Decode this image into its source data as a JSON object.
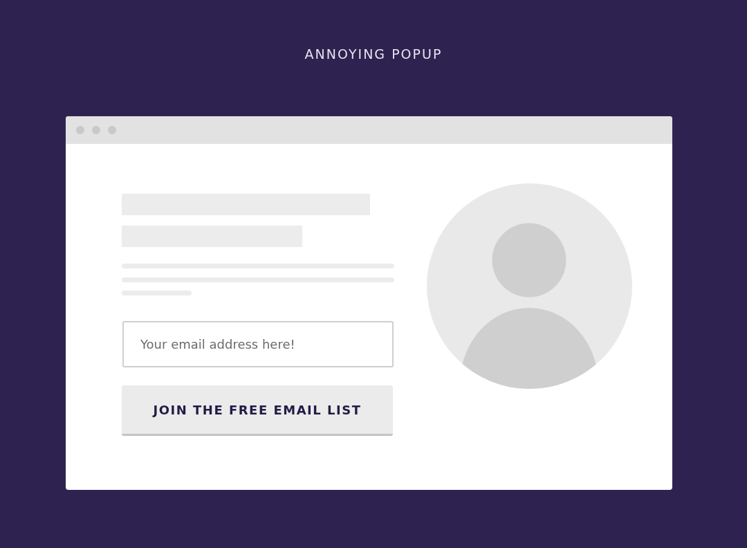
{
  "heading": "ANNOYING POPUP",
  "email_field": {
    "placeholder": "Your email address here!"
  },
  "submit_button": {
    "label": "JOIN THE FREE EMAIL LIST"
  }
}
